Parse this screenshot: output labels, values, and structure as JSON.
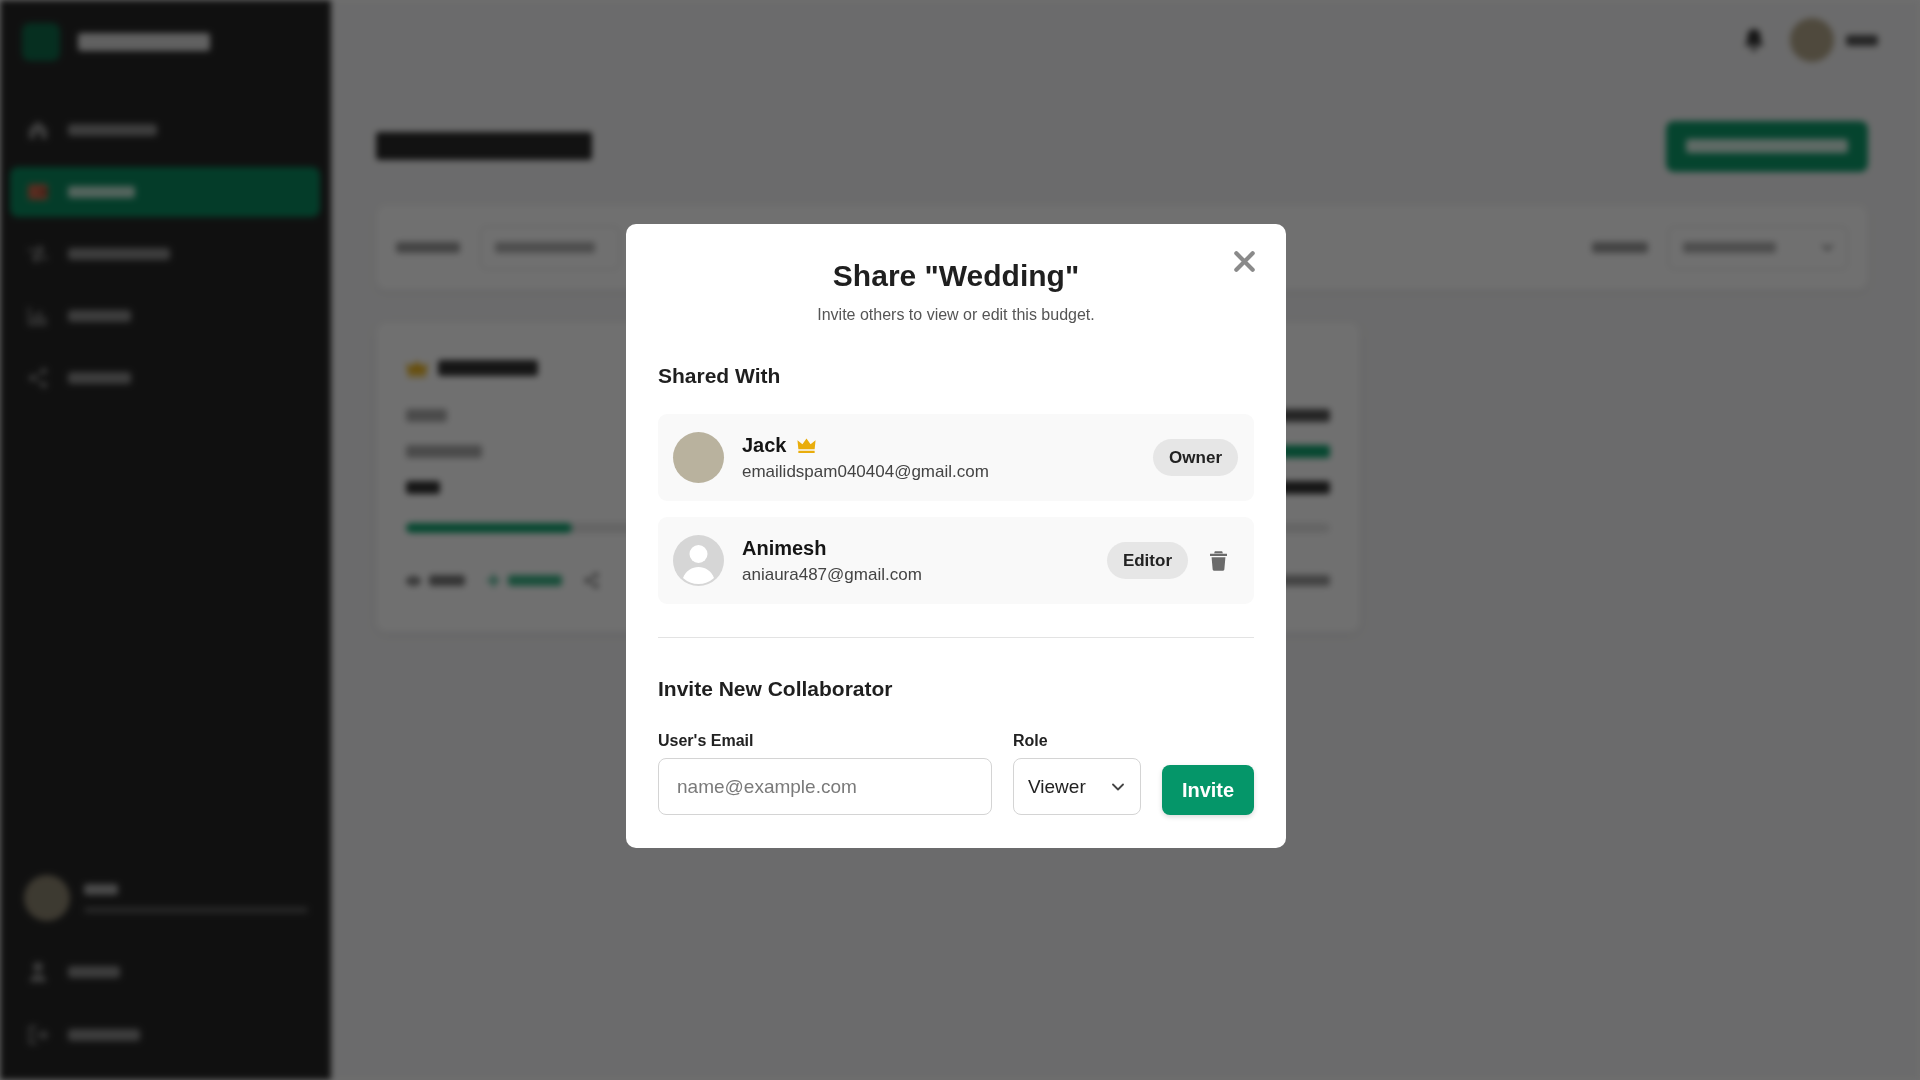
{
  "sidebar": {
    "items": [
      {
        "selected": false
      },
      {
        "selected": true
      },
      {
        "selected": false
      },
      {
        "selected": false
      },
      {
        "selected": false
      }
    ]
  },
  "budget_card": {
    "level": 0.18
  },
  "modal": {
    "title": "Share \"Wedding\"",
    "subtitle": "Invite others to view or edit this budget.",
    "shared_heading": "Shared With",
    "members": [
      {
        "name": "Jack",
        "email": "emailidspam040404@gmail.com",
        "role": "Owner",
        "kind": "owner"
      },
      {
        "name": "Animesh",
        "email": "aniaura487@gmail.com",
        "role": "Editor",
        "kind": "member"
      }
    ],
    "invite_heading": "Invite New Collaborator",
    "email_field": {
      "label": "User's Email",
      "placeholder": "name@example.com"
    },
    "role_field": {
      "label": "Role",
      "value": "Viewer"
    },
    "invite_button": "Invite"
  }
}
